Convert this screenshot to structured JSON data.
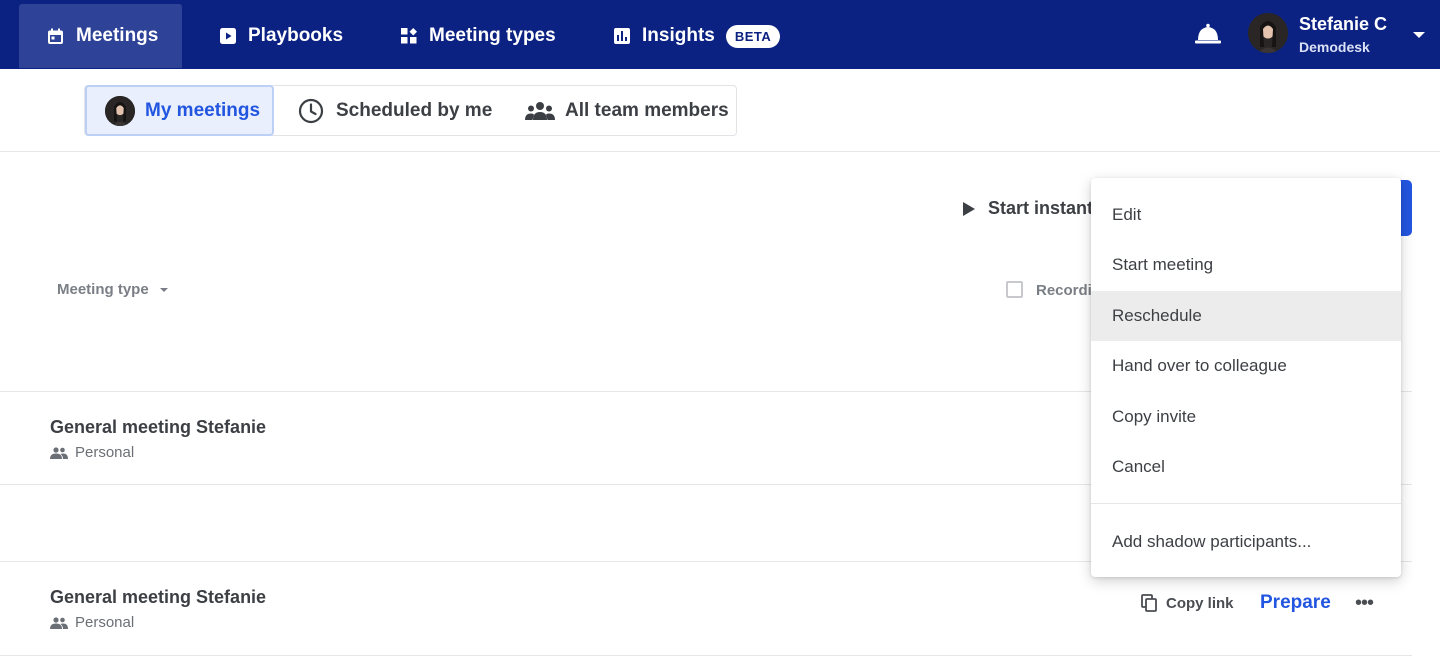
{
  "nav": {
    "meetings": "Meetings",
    "playbooks": "Playbooks",
    "meeting_types": "Meeting types",
    "insights": "Insights",
    "insights_badge": "BETA"
  },
  "user": {
    "name": "Stefanie C",
    "org": "Demodesk"
  },
  "tabs": {
    "my_meetings": "My meetings",
    "scheduled_by_me": "Scheduled by me",
    "all_team_members": "All team members"
  },
  "toolbar": {
    "start_instant": "Start instant",
    "meeting_type_filter": "Meeting type",
    "recording_label": "Recordi"
  },
  "meetings": [
    {
      "title": "General meeting Stefanie",
      "type": "Personal"
    },
    {
      "title": "General meeting Stefanie",
      "type": "Personal"
    }
  ],
  "row_actions": {
    "copy_link": "Copy link",
    "prepare": "Prepare",
    "more": "•••"
  },
  "context_menu": {
    "items": [
      "Edit",
      "Start meeting",
      "Reschedule",
      "Hand over to colleague",
      "Copy invite",
      "Cancel"
    ],
    "extra": "Add shadow participants...",
    "highlighted": "Reschedule"
  },
  "colors": {
    "nav_bg": "#0c2282",
    "accent": "#2356e0",
    "menu_hover": "#ececed"
  }
}
